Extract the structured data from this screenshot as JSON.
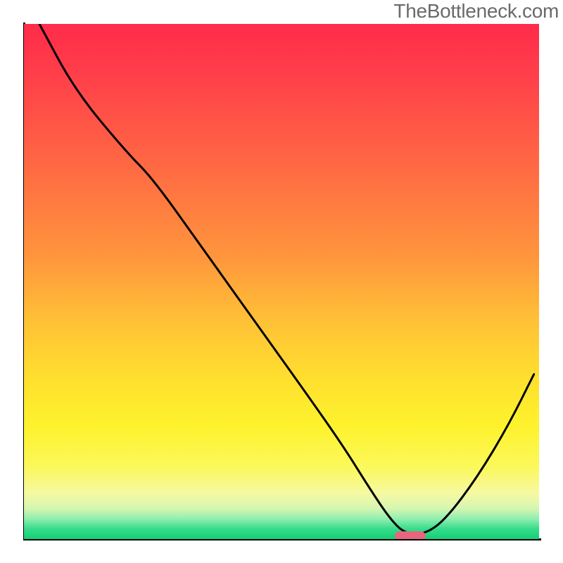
{
  "watermark": "TheBottleneck.com",
  "chart_data": {
    "type": "line",
    "title": "",
    "xlabel": "",
    "ylabel": "",
    "xlim": [
      0,
      100
    ],
    "ylim": [
      0,
      100
    ],
    "grid": false,
    "background": "rainbow-gradient-vertical",
    "series": [
      {
        "name": "bottleneck-curve",
        "x": [
          3,
          10,
          20,
          25,
          35,
          45,
          55,
          62,
          67,
          71,
          74,
          78,
          82,
          88,
          94,
          99
        ],
        "values": [
          100,
          87,
          75,
          70,
          56,
          42,
          28,
          18,
          10,
          4,
          1,
          1,
          4,
          12,
          22,
          32
        ]
      }
    ],
    "markers": [
      {
        "name": "optimal-range-marker",
        "shape": "rounded-rect",
        "color": "#e8657e",
        "x_start": 72,
        "x_end": 78,
        "y": 0.5
      }
    ],
    "gradient_stops": [
      {
        "pos": 0,
        "color": "#ff2b4a"
      },
      {
        "pos": 45,
        "color": "#ff953d"
      },
      {
        "pos": 78,
        "color": "#fef22d"
      },
      {
        "pos": 100,
        "color": "#13cf76"
      }
    ]
  }
}
